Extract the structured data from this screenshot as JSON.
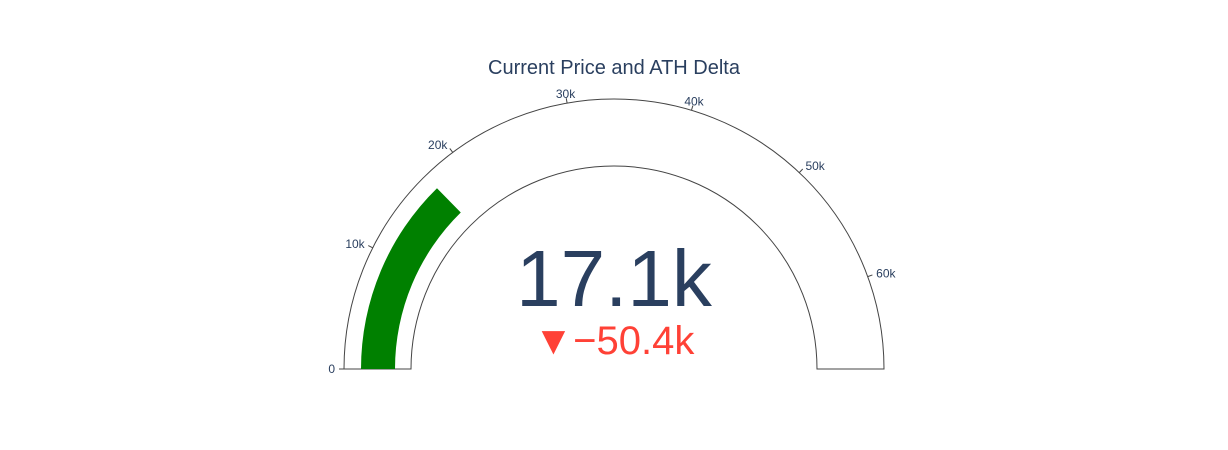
{
  "chart_data": {
    "type": "gauge",
    "title": "Current Price and ATH Delta",
    "value": 17100,
    "value_label": "17.1k",
    "delta": -50400,
    "delta_label": "▼−50.4k",
    "axis_range": [
      0,
      67500
    ],
    "ticks": [
      0,
      10000,
      20000,
      30000,
      40000,
      50000,
      60000
    ],
    "tick_labels": [
      "0",
      "10k",
      "20k",
      "30k",
      "40k",
      "50k",
      "60k"
    ],
    "colors": {
      "bar": "#008000",
      "text": "#2a3f5f",
      "delta_decreasing": "#ff4136",
      "outline": "#444444"
    }
  }
}
